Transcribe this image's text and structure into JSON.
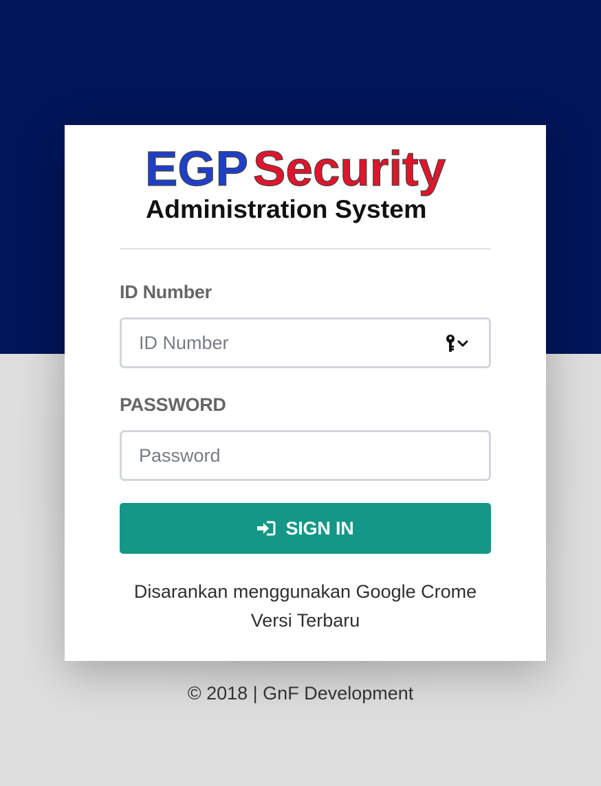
{
  "logo": {
    "brand_part1": "EGP",
    "brand_part2": "Security",
    "tagline": "Administration System",
    "colors": {
      "part1": "#1f3fc7",
      "part2": "#e0142b",
      "tagline": "#111111"
    }
  },
  "form": {
    "id_label": "ID Number",
    "id_placeholder": "ID Number",
    "id_value": "",
    "id_icon": "key-icon",
    "password_label": "PASSWORD",
    "password_placeholder": "Password",
    "password_value": "",
    "submit_label": "SIGN IN",
    "submit_icon": "sign-in-icon"
  },
  "note": {
    "line1": "Disarankan menggunakan Google Crome",
    "line2": "Versi Terbaru"
  },
  "footer": {
    "text": "© 2018 | GnF Development"
  },
  "colors": {
    "header_bg": "#011559",
    "page_bg": "#d9d9d9",
    "button_bg": "#159787",
    "label": "#666666"
  }
}
